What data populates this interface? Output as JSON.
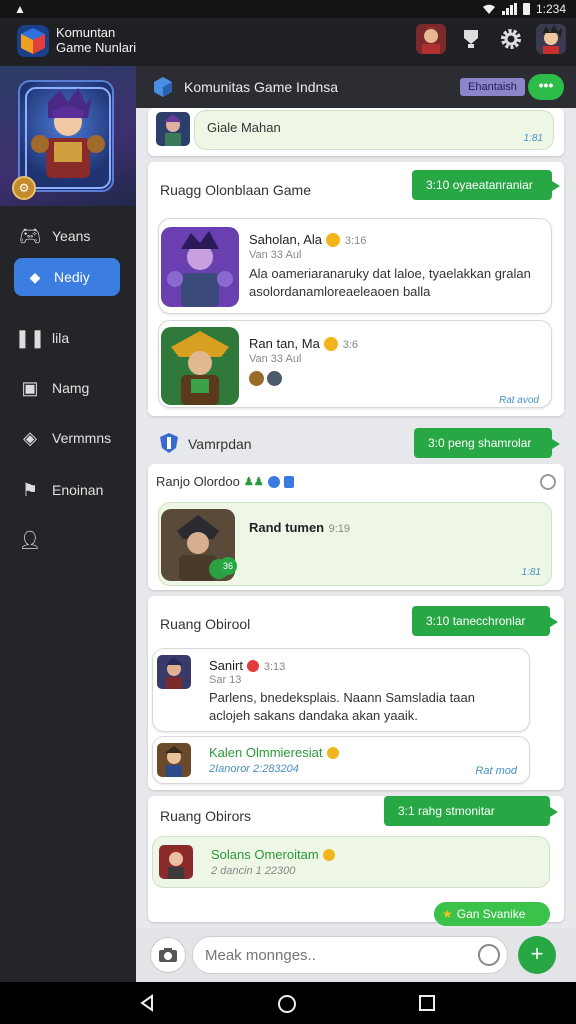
{
  "status_bar": {
    "time": "1:234"
  },
  "app": {
    "title_line1": "Komuntan",
    "title_line2": "Game Nunlari"
  },
  "sidebar": {
    "items": [
      {
        "label": "Yeans",
        "icon": "game-controller-icon"
      },
      {
        "label": "Nediy",
        "icon": "diamond-icon"
      },
      {
        "label": "lila",
        "icon": "chat-icon"
      },
      {
        "label": "Namg",
        "icon": "document-icon"
      },
      {
        "label": "Vermmns",
        "icon": "tag-icon"
      },
      {
        "label": "Enoinan",
        "icon": "flag-icon"
      },
      {
        "label": "",
        "icon": "person-icon"
      }
    ]
  },
  "chat_header": {
    "title": "Komunitas Game Indnsa",
    "tag": "Ehantaish",
    "more": "•••"
  },
  "top_message": {
    "text": "Giale Mahan",
    "time": "1:81"
  },
  "room1": {
    "label": "Ruagg Olonblaan Game",
    "pill": "3:10 oyaeatanraniar",
    "msgs": [
      {
        "sender": "Saholan, Ala",
        "meta_num": "3:16",
        "meta": "Van 33 Aul",
        "text": "Ala oameriaranaruky dat laloe, tyaelakkan gralan asolordanamloreaeleaoen balla"
      },
      {
        "sender": "Ran tan, Ma",
        "meta_num": "3:6",
        "meta": "Van 33 Aul",
        "time": "Rat avod"
      }
    ]
  },
  "room2": {
    "title": "Vamrpdan",
    "pill": "3:0 peng shamrolar",
    "row_label": "Ranjo Olordoo",
    "msg": {
      "sender": "Rand tumen",
      "meta_num": "9:19",
      "time": "1:81",
      "badge": "36"
    }
  },
  "room3": {
    "label": "Ruang Obirool",
    "pill": "3:10 tanecchronlar",
    "msgs": [
      {
        "sender": "Sanirt",
        "meta_num": "3:13",
        "meta": "Sar 13",
        "text": "Parlens, bnedeksplais. Naann Samsladia taan aclojeh sakans dandaka akan yaaik."
      },
      {
        "sender": "Kalen Olmmieresiat",
        "meta": "2Ianoror 2:283204",
        "time": "Rat mod"
      }
    ]
  },
  "room4": {
    "label": "Ruang Obirors",
    "pill": "3:1 rahg stmonitar",
    "msg": {
      "sender": "Solans Omeroitam",
      "meta": "2 dancin 1 22300"
    }
  },
  "badge": {
    "label": "Gan Svanike"
  },
  "input": {
    "placeholder": "Meak monnges.."
  },
  "colors": {
    "accent_green": "#28a745",
    "accent_blue": "#3b7de0"
  }
}
